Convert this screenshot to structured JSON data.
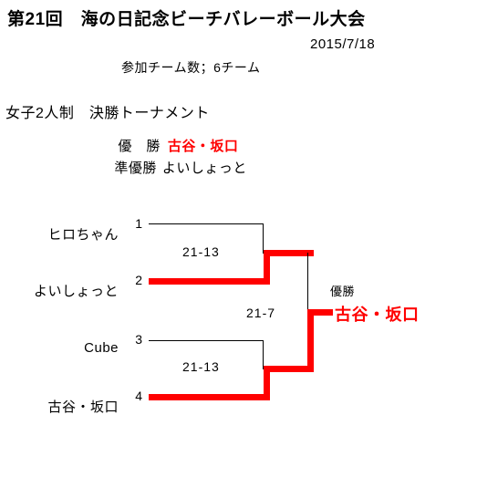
{
  "header": {
    "title": "第21回　海の日記念ビーチバレーボール大会",
    "date": "2015/7/18",
    "team_count": "参加チーム数；6チーム",
    "division": "女子2人制　決勝トーナメント",
    "champion_label": "優　勝",
    "champion_name": "古谷・坂口",
    "runnerup_label": "準優勝",
    "runnerup_name": "よいしょっと"
  },
  "bracket": {
    "seeds": [
      "1",
      "2",
      "3",
      "4"
    ],
    "teams": [
      {
        "seed": "1",
        "name": "ヒロちゃん",
        "winner": false
      },
      {
        "seed": "2",
        "name": "よいしょっと",
        "winner": true
      },
      {
        "seed": "3",
        "name": "Cube",
        "winner": false
      },
      {
        "seed": "4",
        "name": "古谷・坂口",
        "winner": true
      }
    ],
    "matches": [
      {
        "id": "semifinal-top",
        "score": "21-13"
      },
      {
        "id": "final",
        "score": "21-7"
      },
      {
        "id": "semifinal-bottom",
        "score": "21-13"
      }
    ],
    "final": {
      "label": "優勝",
      "winner": "古谷・坂口"
    },
    "colors": {
      "winner_line": "#ff0000",
      "loser_line": "#000000"
    }
  }
}
